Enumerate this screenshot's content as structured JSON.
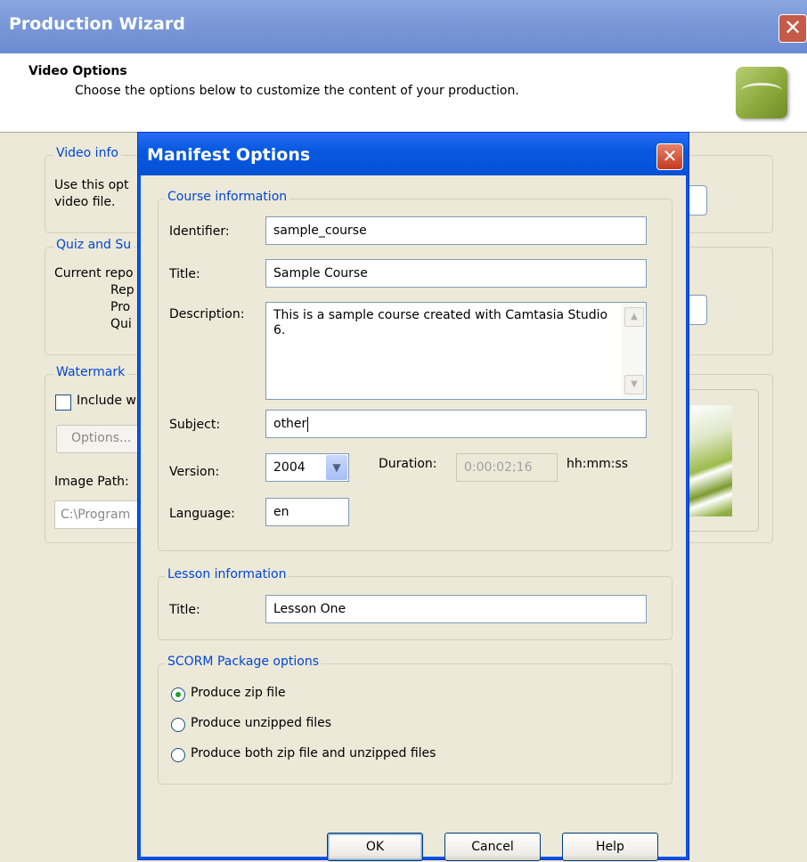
{
  "wizard": {
    "title": "Production Wizard",
    "close_glyph": "✕",
    "header_title": "Video Options",
    "header_subtitle": "Choose the options below to customize the content of your production.",
    "groups": {
      "video_info": {
        "title": "Video info",
        "text1": "Use this opt",
        "text2": "video file."
      },
      "quiz": {
        "title": "Quiz and Su",
        "line1": "Current repo",
        "line2": "Rep",
        "line3": "Pro",
        "line4": "Qui"
      },
      "watermark": {
        "title": "Watermark",
        "include_label": "Include w",
        "options_button": "Options...",
        "image_path_label": "Image Path:",
        "image_path_value": "C:\\Program"
      }
    }
  },
  "dialog": {
    "title": "Manifest Options",
    "close_glyph": "✕",
    "course": {
      "group_title": "Course information",
      "identifier_label": "Identifier:",
      "identifier_value": "sample_course",
      "title_label": "Title:",
      "title_value": "Sample Course",
      "description_label": "Description:",
      "description_value": "This is a sample course created with Camtasia Studio 6.",
      "subject_label": "Subject:",
      "subject_value": "other",
      "version_label": "Version:",
      "version_value": "2004",
      "duration_label": "Duration:",
      "duration_value": "0:00:02;16",
      "duration_units": "hh:mm:ss",
      "language_label": "Language:",
      "language_value": "en"
    },
    "lesson": {
      "group_title": "Lesson information",
      "title_label": "Title:",
      "title_value": "Lesson One"
    },
    "scorm": {
      "group_title": "SCORM Package options",
      "options": [
        "Produce zip file",
        "Produce unzipped files",
        "Produce both zip file and unzipped files"
      ],
      "selected_index": 0
    },
    "buttons": {
      "ok": "OK",
      "cancel": "Cancel",
      "help": "Help"
    }
  }
}
